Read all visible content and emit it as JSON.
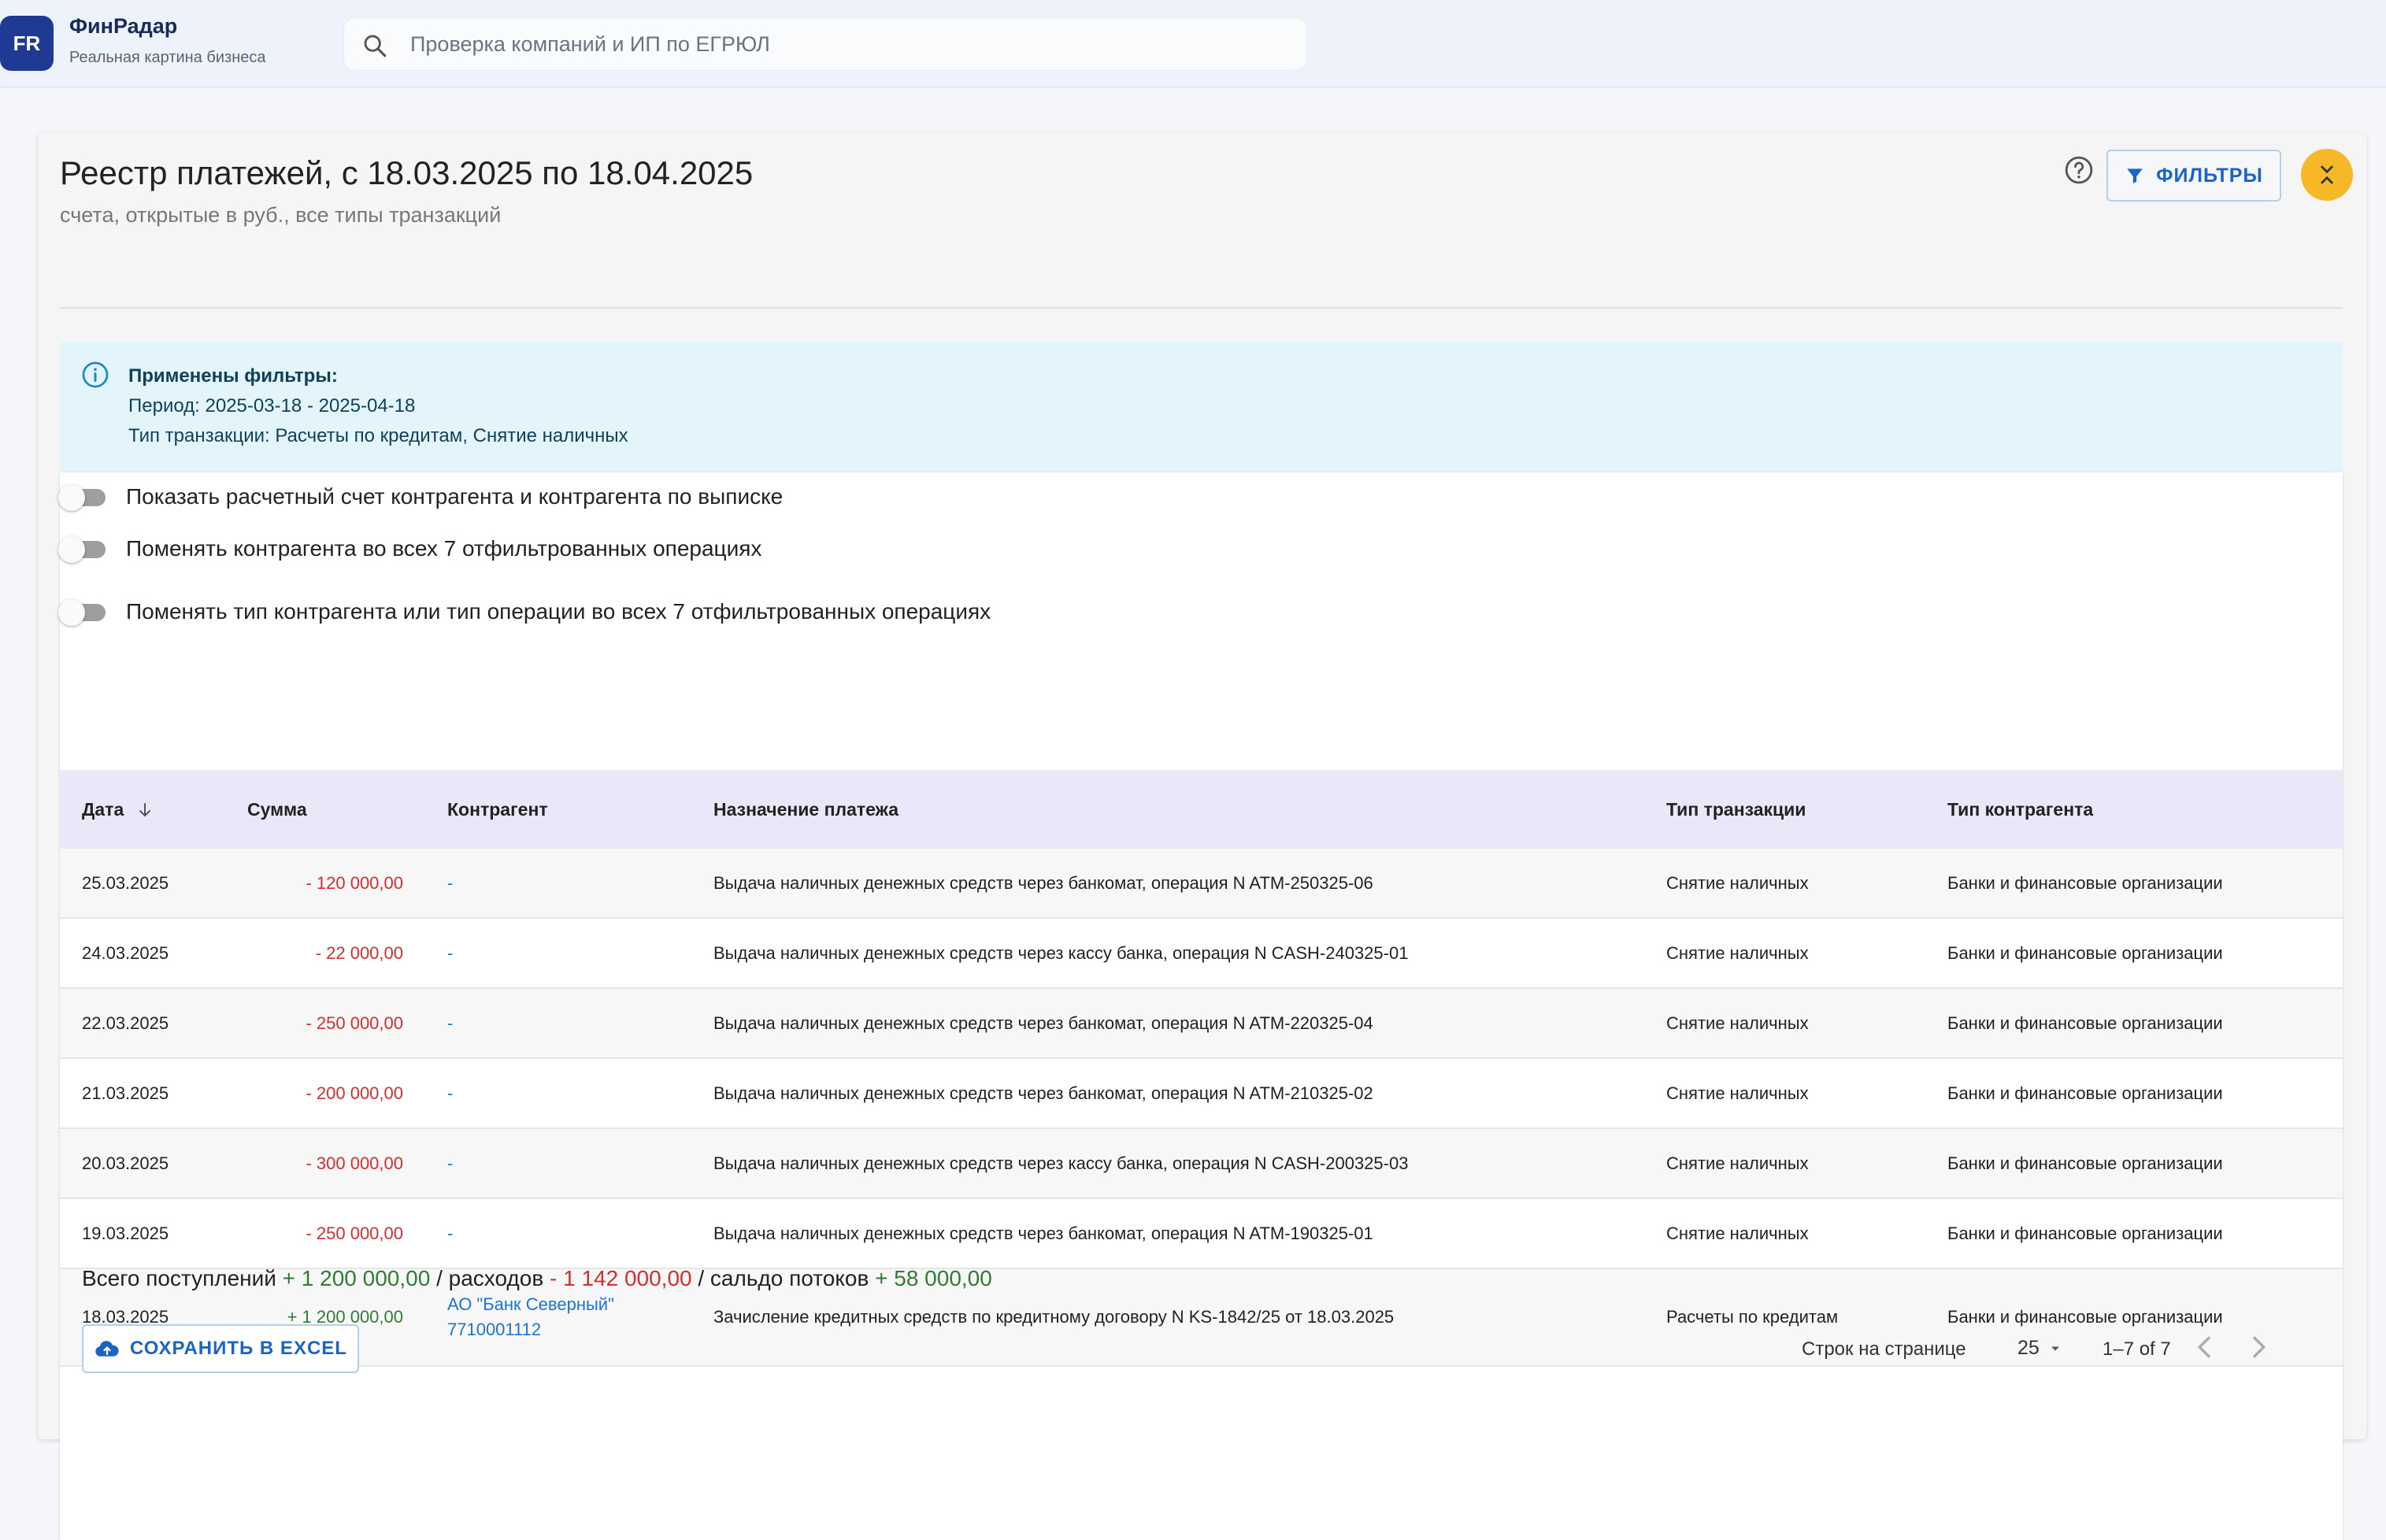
{
  "header": {
    "logo_text": "FR",
    "brand_name": "ФинРадар",
    "brand_tagline": "Реальная картина бизнеса",
    "search_placeholder": "Проверка компаний и ИП по ЕГРЮЛ"
  },
  "page": {
    "title": "Реестр платежей, с 18.03.2025 по 18.04.2025",
    "subtitle": "счета, открытые в руб., все типы транзакций",
    "filters_button": "ФИЛЬТРЫ"
  },
  "info": {
    "title": "Применены фильтры:",
    "period": "Период: 2025-03-18 - 2025-04-18",
    "types": "Тип транзакции: Расчеты по кредитам, Снятие наличных"
  },
  "toggles": [
    {
      "label": "Показать расчетный счет контрагента и контрагента по выписке",
      "on": false
    },
    {
      "label": "Поменять контрагента во всех 7 отфильтрованных операциях",
      "on": false
    },
    {
      "label": "Поменять тип контрагента или тип операции во всех 7 отфильтрованных операциях",
      "on": false
    }
  ],
  "table": {
    "columns": [
      "Дата",
      "Сумма",
      "Контрагент",
      "Назначение платежа",
      "Тип транзакции",
      "Тип контрагента"
    ],
    "rows": [
      {
        "date": "25.03.2025",
        "sum": "- 120 000,00",
        "cp": "-",
        "cp_inn": "",
        "purpose": "Выдача наличных денежных средств через банкомат, операция N ATM-250325-06",
        "type": "Снятие наличных",
        "ctype": "Банки и финансовые организации",
        "sign": "neg"
      },
      {
        "date": "24.03.2025",
        "sum": "- 22 000,00",
        "cp": "-",
        "cp_inn": "",
        "purpose": "Выдача наличных денежных средств через кассу банка, операция N CASH-240325-01",
        "type": "Снятие наличных",
        "ctype": "Банки и финансовые организации",
        "sign": "neg"
      },
      {
        "date": "22.03.2025",
        "sum": "- 250 000,00",
        "cp": "-",
        "cp_inn": "",
        "purpose": "Выдача наличных денежных средств через банкомат, операция N ATM-220325-04",
        "type": "Снятие наличных",
        "ctype": "Банки и финансовые организации",
        "sign": "neg"
      },
      {
        "date": "21.03.2025",
        "sum": "- 200 000,00",
        "cp": "-",
        "cp_inn": "",
        "purpose": "Выдача наличных денежных средств через банкомат, операция N ATM-210325-02",
        "type": "Снятие наличных",
        "ctype": "Банки и финансовые организации",
        "sign": "neg"
      },
      {
        "date": "20.03.2025",
        "sum": "- 300 000,00",
        "cp": "-",
        "cp_inn": "",
        "purpose": "Выдача наличных денежных средств через кассу банка, операция N CASH-200325-03",
        "type": "Снятие наличных",
        "ctype": "Банки и финансовые организации",
        "sign": "neg"
      },
      {
        "date": "19.03.2025",
        "sum": "- 250 000,00",
        "cp": "-",
        "cp_inn": "",
        "purpose": "Выдача наличных денежных средств через банкомат, операция N ATM-190325-01",
        "type": "Снятие наличных",
        "ctype": "Банки и финансовые организации",
        "sign": "neg"
      },
      {
        "date": "18.03.2025",
        "sum": "+ 1 200 000,00",
        "cp": "АО \"Банк Северный\"",
        "cp_inn": "7710001112",
        "purpose": "Зачисление кредитных средств по кредитному договору N KS-1842/25 от 18.03.2025",
        "type": "Расчеты по кредитам",
        "ctype": "Банки и финансовые организации",
        "sign": "pos"
      }
    ]
  },
  "totals": {
    "income_label": "Всего поступлений",
    "income": "+ 1 200 000,00",
    "expense_label": "/ расходов",
    "expense": "- 1 142 000,00",
    "balance_label": "/ сальдо потоков",
    "balance": "+ 58 000,00"
  },
  "footer": {
    "excel_button": "СОХРАНИТЬ В EXCEL",
    "rows_per_page_label": "Строк на странице",
    "rows_per_page": "25",
    "range": "1–7 of 7"
  },
  "colors": {
    "accent": "#1a64c8",
    "negative": "#d32f2f",
    "positive": "#2e7d32",
    "brand": "#1f3a93",
    "collapse_button": "#f6b826",
    "info_bg": "#e3f5fb",
    "table_header_bg": "#e8e8f8"
  },
  "icons": {
    "search": "search-icon",
    "help": "help-circle-icon",
    "filter": "filter-funnel-icon",
    "collapse": "collapse-chevrons-icon",
    "info": "info-circle-icon",
    "sort": "arrow-down-icon",
    "cloud": "cloud-upload-icon",
    "dropdown": "caret-down-icon",
    "prev": "chevron-left-icon",
    "next": "chevron-right-icon"
  }
}
